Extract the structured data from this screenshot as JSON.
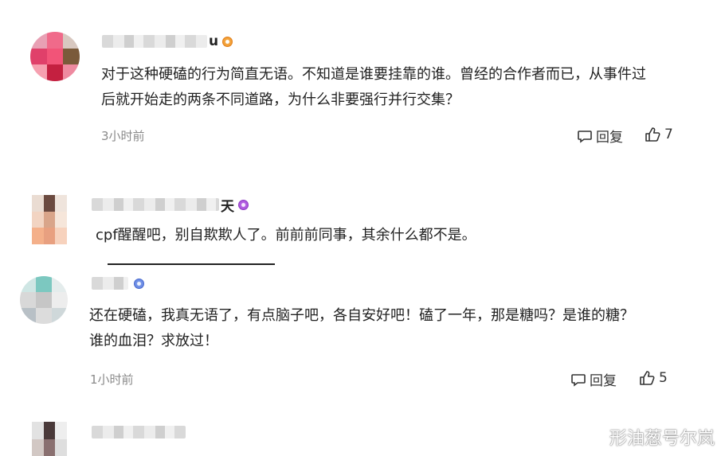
{
  "comments": [
    {
      "username_visible": "u",
      "badge": "gold",
      "text": "对于这种硬磕的行为简直无语。不知道是谁要挂靠的谁。曾经的合作者而已，从事件过\n后就开始走的两条不同道路，为什么非要强行并行交集？",
      "time": "3小时前",
      "reply_label": "回复",
      "like_count": "7"
    },
    {
      "username_visible": "天",
      "badge": "purple",
      "text": "cpf醒醒吧，别自欺欺人了。前前前同事，其余什么都不是。"
    },
    {
      "username_visible": "",
      "badge": "blue",
      "text": "还在硬磕，我真无语了，有点脑子吧，各自安好吧！磕了一年，那是糖吗？是谁的糖？\n谁的血泪？求放过！",
      "time": "1小时前",
      "reply_label": "回复",
      "like_count": "5"
    }
  ],
  "watermark": {
    "text": "形油葱号尔岚",
    "icon": "weibo-icon"
  },
  "colors": {
    "gold_badge": "#e07a14",
    "purple_badge": "#8a35c0",
    "blue_badge": "#4466cc",
    "meta_text": "#8a8a8a"
  }
}
